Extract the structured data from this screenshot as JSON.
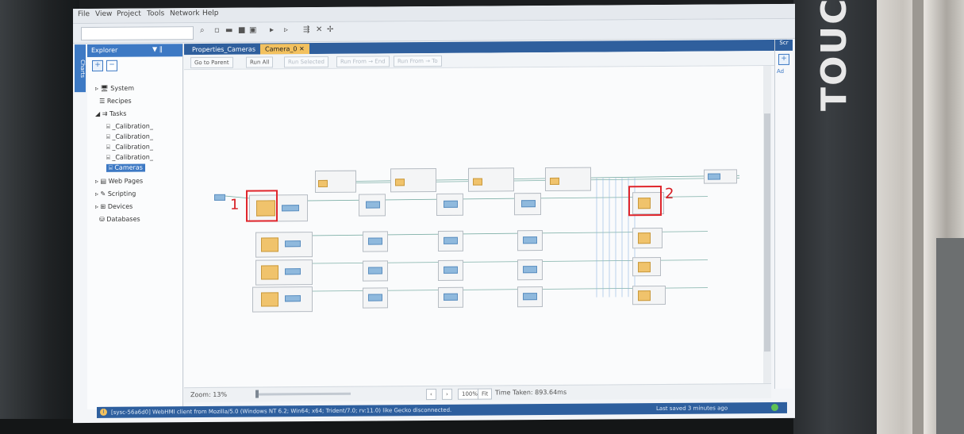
{
  "menu": [
    "File",
    "View",
    "Project",
    "Tools",
    "Network",
    "Help"
  ],
  "explorer": {
    "title": "Explorer",
    "pin": "▼ ‖",
    "side_tab": "Charts",
    "items": [
      {
        "label": "System",
        "icon": "monitor-icon"
      },
      {
        "label": "Recipes",
        "icon": "list-icon"
      },
      {
        "label": "Tasks",
        "icon": "tasks-icon"
      },
      {
        "label": "_Calibration_",
        "icon": "task-icon"
      },
      {
        "label": "_Calibration_",
        "icon": "task-icon"
      },
      {
        "label": "_Calibration_",
        "icon": "task-icon"
      },
      {
        "label": "_Calibration_",
        "icon": "task-icon"
      },
      {
        "label": "Cameras",
        "icon": "task-icon"
      },
      {
        "label": "Web Pages",
        "icon": "web-icon"
      },
      {
        "label": "Scripting",
        "icon": "script-icon"
      },
      {
        "label": "Devices",
        "icon": "devices-icon"
      },
      {
        "label": "Databases",
        "icon": "database-icon"
      }
    ]
  },
  "tabs": {
    "properties": "Properties_Cameras",
    "camera": "Camera_0",
    "close": "✕"
  },
  "graph_toolbar": {
    "go_parent": "Go to Parent",
    "run_all": "Run All",
    "run_selected": "Run Selected",
    "run_from_end": "Run From → End",
    "run_from_to": "Run From → To"
  },
  "annotations": {
    "one": "1",
    "two": "2"
  },
  "right_panel": {
    "title": "Scr",
    "ad": "Ad"
  },
  "zoom": {
    "label": "Zoom: 13%",
    "level_fraction": 0.0,
    "btn_100": "100%",
    "btn_fit": "Fit",
    "time_taken": "Time Taken: 893.64ms"
  },
  "status": {
    "text": "[sysc-56a6d0] WebHMI client from Mozilla/5.0 (Windows NT 6.2; Win64; x64; Trident/7.0; rv:11.0) like Gecko disconnected.",
    "last_saved": "Last saved 3 minutes ago"
  },
  "bezel": {
    "brand": "TOUCH"
  },
  "colors": {
    "accent_blue": "#3d79c4",
    "tab_active": "#f3c15e",
    "node_core": "#f0c36c",
    "highlight": "#e0262c"
  }
}
